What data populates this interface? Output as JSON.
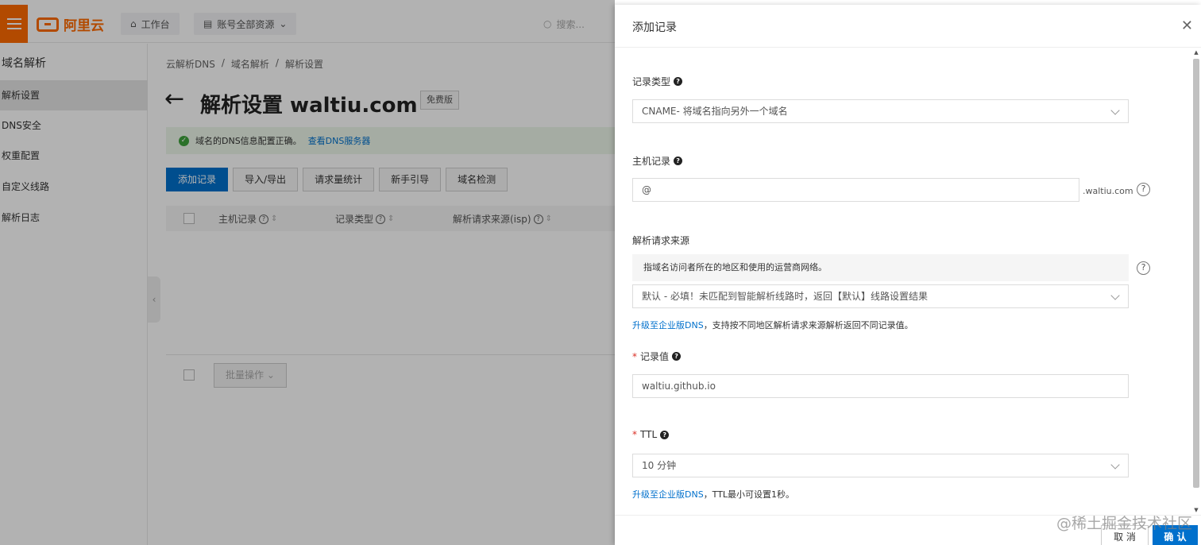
{
  "topbar": {
    "logo_text": "阿里云",
    "workbench_label": "工作台",
    "resources_label": "账号全部资源",
    "search_placeholder": "搜索..."
  },
  "sidebar": {
    "title": "域名解析",
    "items": [
      {
        "label": "解析设置",
        "active": true
      },
      {
        "label": "DNS安全",
        "active": false
      },
      {
        "label": "权重配置",
        "active": false
      },
      {
        "label": "自定义线路",
        "active": false
      },
      {
        "label": "解析日志",
        "active": false
      }
    ]
  },
  "breadcrumb": [
    "云解析DNS",
    "/",
    "域名解析",
    "/",
    "解析设置"
  ],
  "page": {
    "title": "解析设置 waltiu.com",
    "badge": "免费版"
  },
  "notice": {
    "text": "域名的DNS信息配置正确。",
    "link": "查看DNS服务器"
  },
  "toolbar": {
    "add_record": "添加记录",
    "import_export": "导入/导出",
    "request_stats": "请求量统计",
    "guide": "新手引导",
    "domain_check": "域名检测"
  },
  "table": {
    "columns": [
      "主机记录",
      "记录类型",
      "解析请求来源(isp)"
    ],
    "batch_label": "批量操作"
  },
  "drawer": {
    "title": "添加记录",
    "record_type_label": "记录类型",
    "record_type_value": "CNAME- 将域名指向另外一个域名",
    "host_label": "主机记录",
    "host_value": "@",
    "host_suffix": ".waltiu.com",
    "source_label": "解析请求来源",
    "source_hint": "指域名访问者所在的地区和使用的运营商网络。",
    "source_value": "默认 - 必填！未匹配到智能解析线路时，返回【默认】线路设置结果",
    "source_note_link": "升级至企业版DNS",
    "source_note_text": "，支持按不同地区解析请求来源解析返回不同记录值。",
    "value_label": "记录值",
    "value_value": "waltiu.github.io",
    "ttl_label": "TTL",
    "ttl_value": "10 分钟",
    "ttl_note_link": "升级至企业版DNS",
    "ttl_note_text": "，TTL最小可设置1秒。",
    "cancel": "取 消",
    "confirm": "确 认"
  },
  "watermark": "@稀土掘金技术社区"
}
